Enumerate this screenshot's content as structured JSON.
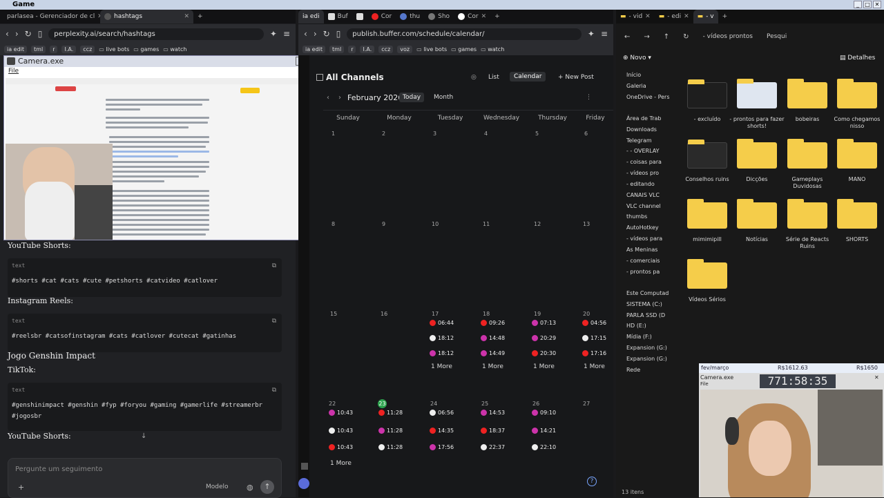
{
  "window": {
    "title": "Game",
    "controls": [
      "_",
      "□",
      "✕"
    ]
  },
  "browser1": {
    "tabs": [
      {
        "label": "parlasea - Gerenciador de cl"
      },
      {
        "label": "hashtags"
      },
      {
        "label": "+"
      }
    ],
    "url": "perplexity.ai/search/hashtags",
    "bookmarks": {
      "chips": [
        "ia edit",
        "tml",
        "r",
        "I.A.",
        "ccz"
      ],
      "folders": [
        "live bots",
        "games",
        "watch"
      ]
    },
    "sections": [
      {
        "heading": "YouTube Shorts:",
        "lang": "text",
        "code": "#shorts #cat #cats #cute #petshorts #catvideo #catlover"
      },
      {
        "heading": "Instagram Reels:",
        "lang": "text",
        "code": "#reelsbr #catsofinstagram #cats #catlover #cutecat #gatinhas"
      },
      {
        "heading": "Jogo Genshin Impact",
        "sub": "TikTok:",
        "lang": "text",
        "code": "#genshinimpact #genshin #fyp #foryou #gaming #gamerlife #streamerbr #jogosbr"
      },
      {
        "heading": "YouTube Shorts:"
      }
    ],
    "ask_placeholder": "Pergunte um seguimento",
    "model_label": "Modelo"
  },
  "camera1": {
    "title": "Camera.exe",
    "menu": "File"
  },
  "browser2": {
    "tabs": [
      "ia edi",
      "Buf",
      "",
      "Cor",
      "thu",
      "Sho",
      "Cor",
      "+"
    ],
    "url": "publish.buffer.com/schedule/calendar/",
    "bookmarks": {
      "chips": [
        "ia edit",
        "tml",
        "r",
        "I.A.",
        "ccz",
        "voz"
      ],
      "folders": [
        "live bots",
        "games",
        "watch"
      ]
    },
    "calendar": {
      "title": "All Channels",
      "view_list": "List",
      "view_calendar": "Calendar",
      "new_post": "+ New Post",
      "month": "February 2026",
      "today": "Today",
      "mode": "Month",
      "days": [
        "Sunday",
        "Monday",
        "Tuesday",
        "Wednesday",
        "Thursday",
        "Friday"
      ],
      "weeks": [
        [
          "1",
          "2",
          "3",
          "4",
          "5",
          "6"
        ],
        [
          "8",
          "9",
          "10",
          "11",
          "12",
          "13"
        ],
        [
          "15",
          "16",
          "17",
          "18",
          "19",
          "20"
        ],
        [
          "22",
          "23",
          "24",
          "25",
          "26",
          "27"
        ]
      ],
      "posts_w3": [
        [
          "06:44",
          "18:12",
          "18:12"
        ],
        [
          "09:26",
          "14:48",
          "14:49"
        ],
        [
          "07:13",
          "20:29",
          "20:30"
        ],
        [
          "04:56",
          "17:15",
          "17:16"
        ]
      ],
      "posts_w4": [
        [
          "10:43",
          "10:43",
          "10:43"
        ],
        [
          "11:28",
          "11:28",
          "11:28"
        ],
        [
          "06:56",
          "14:35",
          "17:56"
        ],
        [
          "14:53",
          "18:37",
          "22:37"
        ],
        [
          "09:10",
          "14:21",
          "22:10"
        ]
      ],
      "more": "1 More"
    }
  },
  "explorer": {
    "tabs": [
      "- vid",
      "- edi",
      "- v"
    ],
    "path": "- vídeos prontos",
    "search": "Pesqui",
    "new": "Novo",
    "details": "Detalhes",
    "sidebar": [
      "Início",
      "Galeria",
      "OneDrive - Pers",
      "Área de Trab",
      "Downloads",
      "Telegram",
      "- - OVERLAY",
      "- coisas para",
      "- vídeos pro",
      "- editando",
      "CANAIS VLC",
      "VLC channel",
      "thumbs",
      "AutoHotkey",
      "- vídeos para",
      "As Meninas",
      "- comerciais",
      "- prontos pa",
      "Este Computad",
      "SISTEMA (C:)",
      "PARLA SSD (D",
      "HD (E:)",
      "Mídia (F:)",
      "Expansion (G:)",
      "Expansion (G:)",
      "Rede"
    ],
    "folders": [
      "- excluído",
      "- prontos para fazer shorts!",
      "bobeiras",
      "Como chegamos nisso",
      "Conselhos ruins",
      "Dicções",
      "Gameplays Duvidosas",
      "MANO",
      "mimimipill",
      "Notícias",
      "Série de Reacts Ruins",
      "SHORTS",
      "Vídeos Sérios"
    ],
    "status": "13 itens"
  },
  "camera2": {
    "header": "fev/março",
    "amount1": "R$1612.63",
    "amount2": "R$1650",
    "title": "Camera.exe",
    "menu": "File",
    "timer": "771:58:35"
  }
}
